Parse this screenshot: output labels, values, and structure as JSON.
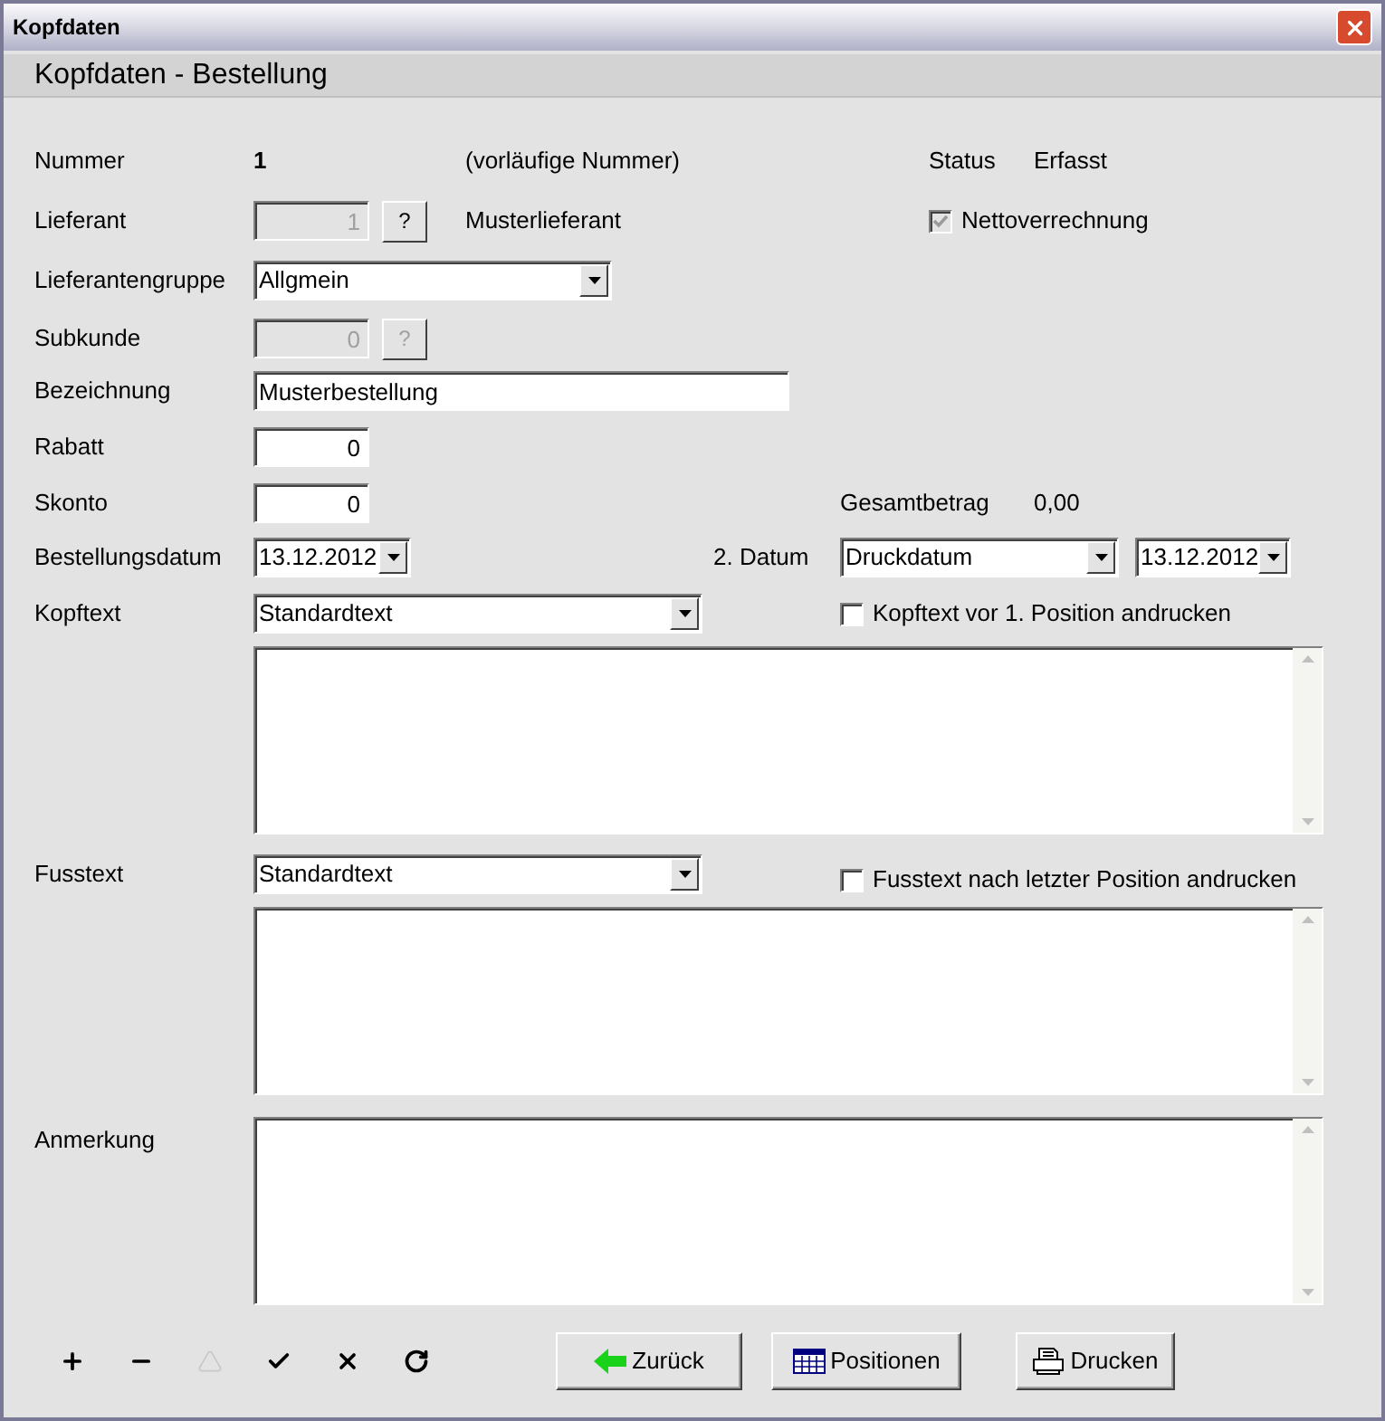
{
  "window": {
    "title": "Kopfdaten"
  },
  "header": "Kopfdaten - Bestellung",
  "nummer": {
    "label": "Nummer",
    "value": "1",
    "note": "(vorläufige Nummer)"
  },
  "status": {
    "label": "Status",
    "value": "Erfasst"
  },
  "lieferant": {
    "label": "Lieferant",
    "value": "1",
    "disabled": true,
    "lookup": "?",
    "name": "Musterlieferant"
  },
  "nettoverrechnung": {
    "label": "Nettoverrechnung",
    "checked": true,
    "disabled": true
  },
  "lieferantengruppe": {
    "label": "Lieferantengruppe",
    "value": "Allgmein"
  },
  "subkunde": {
    "label": "Subkunde",
    "value": "0",
    "disabled": true,
    "lookup": "?"
  },
  "bezeichnung": {
    "label": "Bezeichnung",
    "value": "Musterbestellung"
  },
  "rabatt": {
    "label": "Rabatt",
    "value": "0"
  },
  "skonto": {
    "label": "Skonto",
    "value": "0"
  },
  "gesamtbetrag": {
    "label": "Gesamtbetrag",
    "value": "0,00"
  },
  "bestellungsdatum": {
    "label": "Bestellungsdatum",
    "value": "13.12.2012"
  },
  "datum2": {
    "label": "2. Datum",
    "type": "Druckdatum",
    "value": "13.12.2012"
  },
  "kopftext": {
    "label": "Kopftext",
    "value": "Standardtext",
    "option": {
      "label": "Kopftext vor 1. Position andrucken",
      "checked": false
    }
  },
  "fusstext": {
    "label": "Fusstext",
    "value": "Standardtext",
    "option": {
      "label": "Fusstext nach letzter Position andrucken",
      "checked": false
    }
  },
  "anmerkung": {
    "label": "Anmerkung"
  },
  "toolbar": [
    {
      "kind": "add",
      "disabled": false
    },
    {
      "kind": "remove",
      "disabled": false
    },
    {
      "kind": "up",
      "disabled": true
    },
    {
      "kind": "confirm",
      "disabled": false
    },
    {
      "kind": "cancel",
      "disabled": false
    },
    {
      "kind": "refresh",
      "disabled": false
    }
  ],
  "buttons": [
    {
      "kind": "back",
      "label": "Zurück"
    },
    {
      "kind": "positions",
      "label": "Positionen"
    },
    {
      "kind": "print",
      "label": "Drucken"
    }
  ]
}
